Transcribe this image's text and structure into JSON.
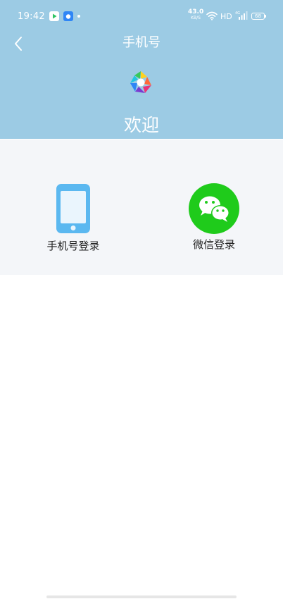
{
  "status_bar": {
    "time": "19:42",
    "net_speed_value": "43.0",
    "net_speed_unit": "KB/S",
    "hd": "HD",
    "network_type": "4G",
    "battery": "68"
  },
  "header": {
    "title": "手机号",
    "welcome": "欢迎",
    "background_color": "#9ccbe4"
  },
  "login_options": {
    "phone": {
      "label": "手机号登录",
      "icon": "smartphone-icon",
      "color": "#5bb8f0"
    },
    "wechat": {
      "label": "微信登录",
      "icon": "wechat-icon",
      "color": "#1fcb1b"
    }
  }
}
